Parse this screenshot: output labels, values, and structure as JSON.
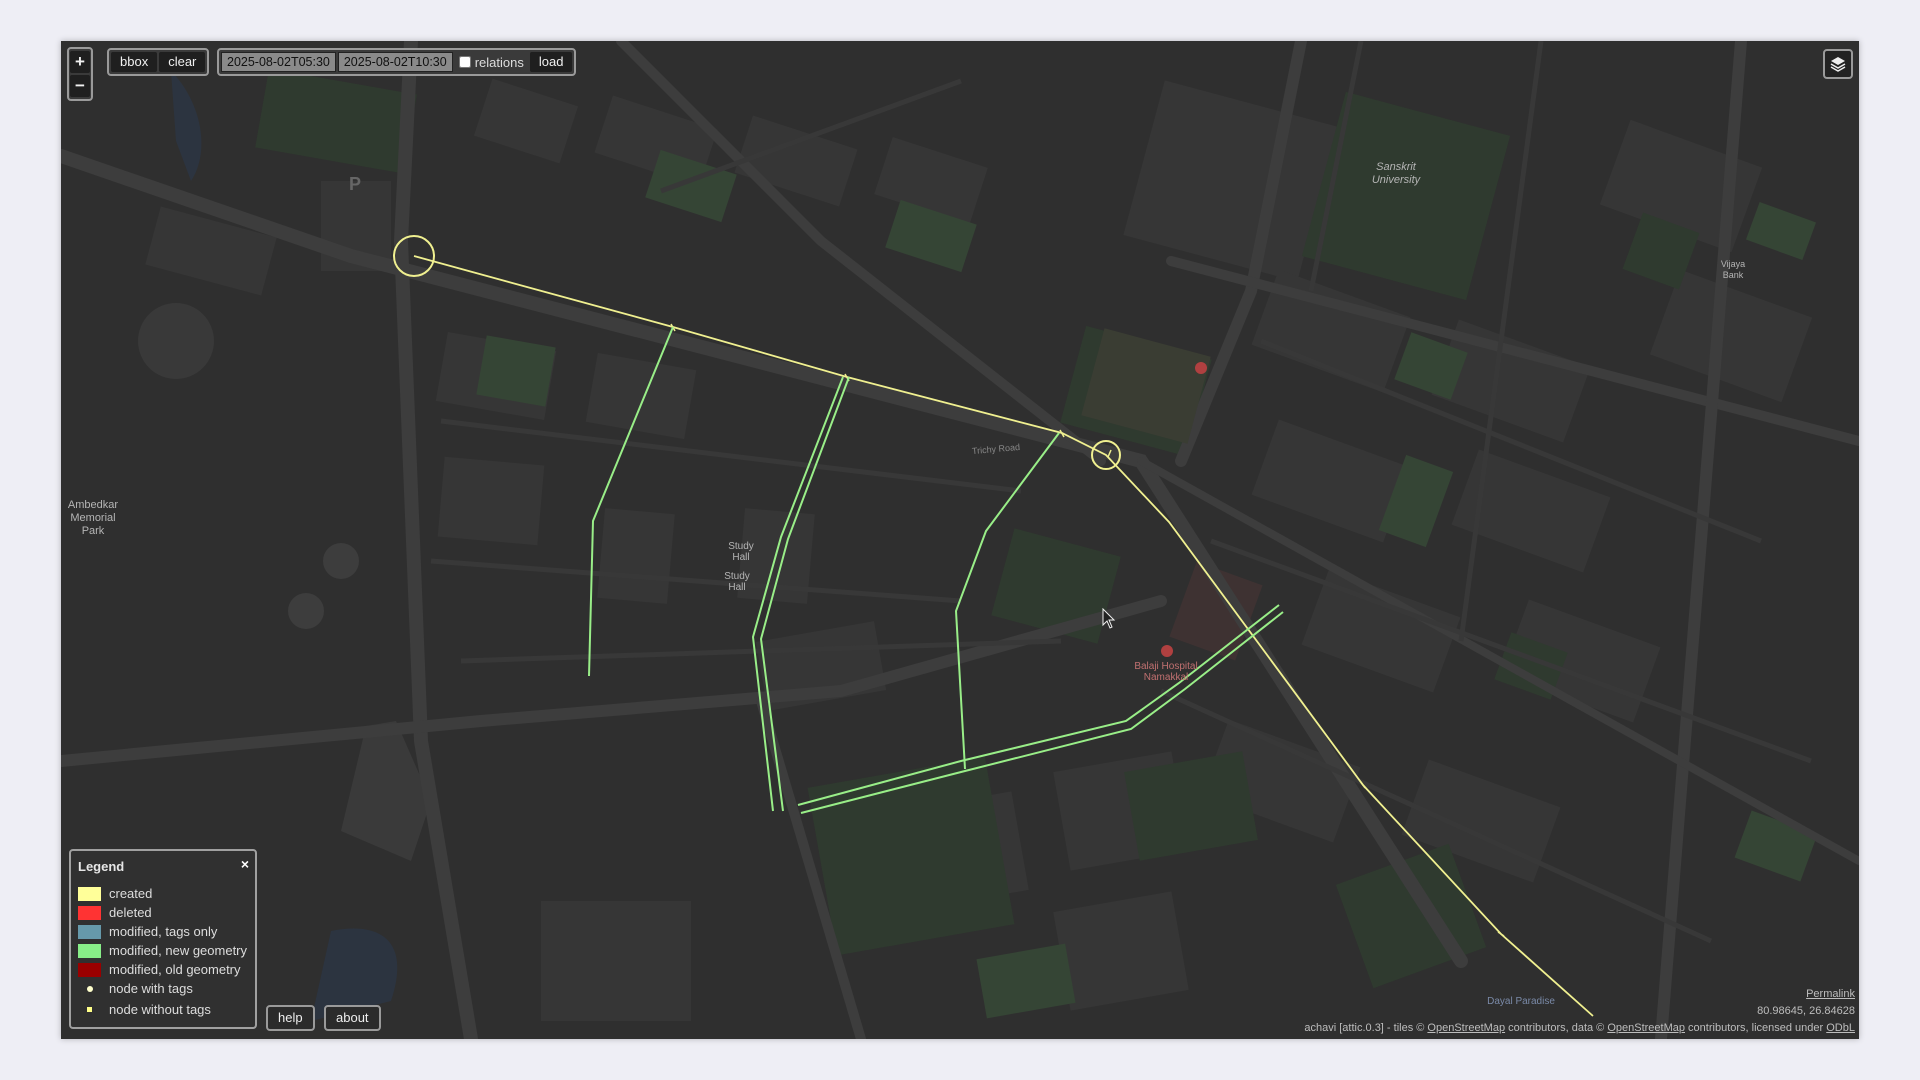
{
  "toolbar": {
    "zoom_in": "+",
    "zoom_out": "−",
    "bbox_label": "bbox",
    "clear_label": "clear",
    "start_time": "2025-08-02T05:30",
    "end_time": "2025-08-02T10:30",
    "relations_label": "relations",
    "relations_checked": false,
    "load_label": "load"
  },
  "map_labels": {
    "park": "Ambedkar Memorial Park",
    "university": "Sanskrit University",
    "bank": "Vijaya Bank",
    "study_hall_1": "Study Hall",
    "study_hall_2": "Study Hall",
    "hospital": "Balaji Hospital Namakkal",
    "paradise": "Dayal Paradise",
    "road": "Trichy Road",
    "parking": "P"
  },
  "legend": {
    "title": "Legend",
    "close": "×",
    "items": [
      {
        "label": "created",
        "color": "#ffff99"
      },
      {
        "label": "deleted",
        "color": "#ff3333"
      },
      {
        "label": "modified, tags only",
        "color": "#6699aa"
      },
      {
        "label": "modified, new geometry",
        "color": "#88ee88"
      },
      {
        "label": "modified, old geometry",
        "color": "#990000"
      },
      {
        "label": "node with tags",
        "color": "#ffffcc"
      },
      {
        "label": "node without tags",
        "color": "#ffff88"
      }
    ]
  },
  "footer": {
    "help_label": "help",
    "about_label": "about",
    "permalink": "Permalink",
    "coords": "80.98645, 26.84628",
    "attribution_prefix": "achavi [attic.0.3]  -  tiles © ",
    "osm_link": "OpenStreetMap",
    "attribution_mid": " contributors, data © ",
    "osm_link2": "OpenStreetMap",
    "attribution_end": " contributors, licensed under ",
    "odbl": "ODbL"
  },
  "colors": {
    "created": "#ffff99",
    "new_geometry": "#99ee88",
    "map_bg": "#2f2f2f"
  }
}
